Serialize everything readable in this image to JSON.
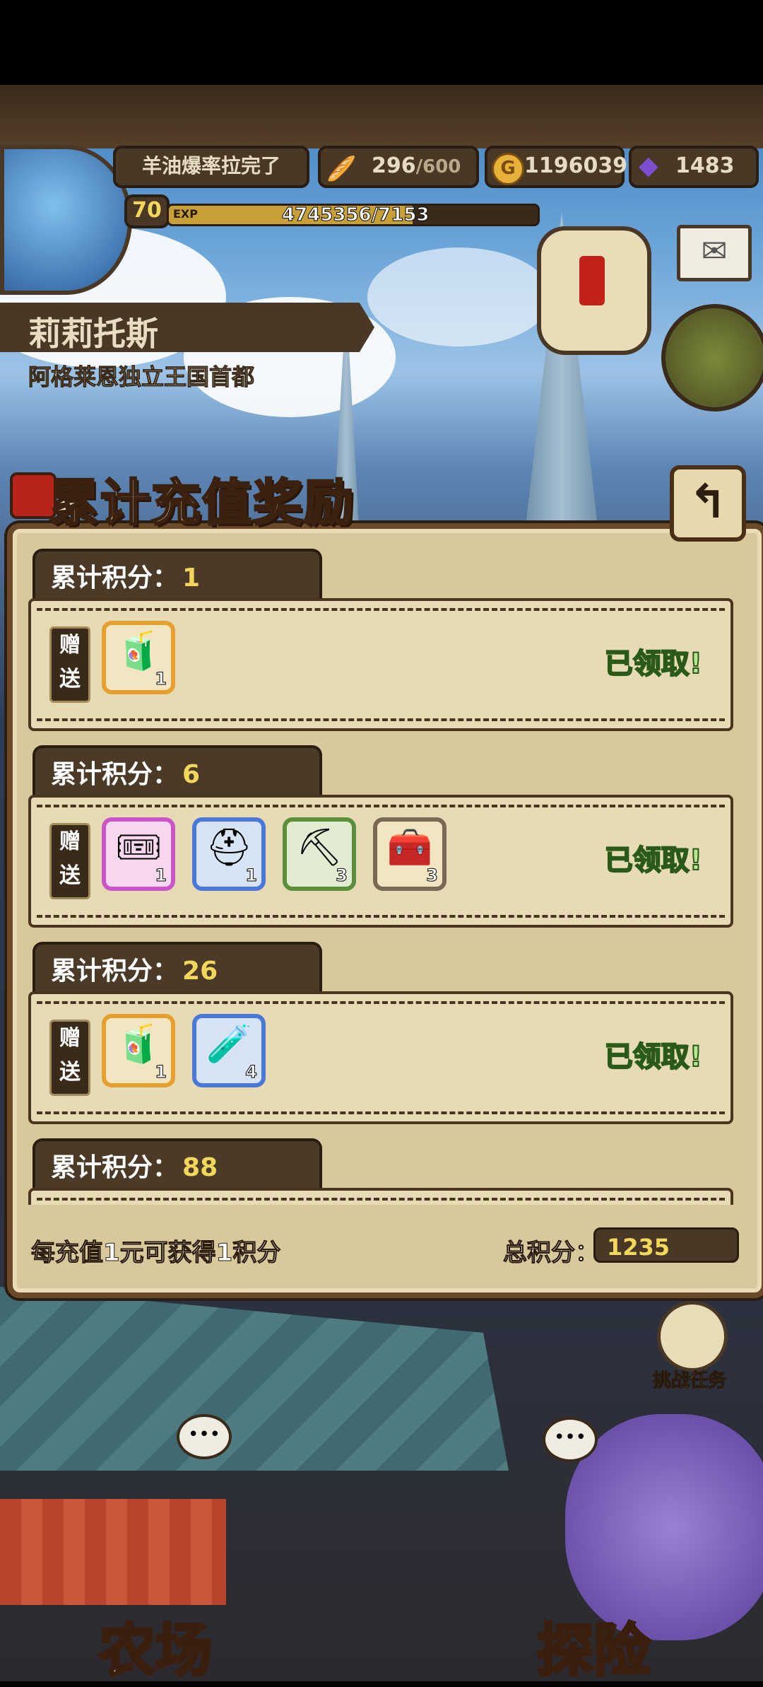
{
  "hud": {
    "player_name": "羊油爆率拉完了",
    "level": "70",
    "exp_label": "EXP",
    "exp_value": "4745356/7153",
    "stamina_current": "296",
    "stamina_max": "/600",
    "gold": "1196039",
    "gems": "1483",
    "stamina_progress": 0.49,
    "exp_progress": 0.66
  },
  "location": {
    "name": "莉莉托斯",
    "subtitle": "阿格莱恩独立王国首都"
  },
  "panel": {
    "title": "累计充值奖励",
    "tiers": [
      {
        "label": "累计积分：",
        "points": "1",
        "gift_label": "赠送",
        "status": "已领取!",
        "items": [
          {
            "icon": "potion-icon",
            "qty": "1",
            "frame": "#e6a030"
          }
        ]
      },
      {
        "label": "累计积分：",
        "points": "6",
        "gift_label": "赠送",
        "status": "已领取!",
        "items": [
          {
            "icon": "ticket-icon",
            "qty": "1",
            "frame": "#c955c9"
          },
          {
            "icon": "helmet-icon",
            "qty": "1",
            "frame": "#4a78d8"
          },
          {
            "icon": "pickaxe-icon",
            "qty": "3",
            "frame": "#5c8f3a"
          },
          {
            "icon": "chest-icon",
            "qty": "3",
            "frame": "#7a6a55"
          }
        ]
      },
      {
        "label": "累计积分：",
        "points": "26",
        "gift_label": "赠送",
        "status": "已领取!",
        "items": [
          {
            "icon": "potion-icon",
            "qty": "1",
            "frame": "#e6a030"
          },
          {
            "icon": "green-tank-icon",
            "qty": "4",
            "frame": "#4a78d8"
          }
        ]
      },
      {
        "label": "累计积分：",
        "points": "88"
      }
    ],
    "footer_note": "每充值1元可获得1积分",
    "total_label": "总积分：",
    "total_value": "1235"
  },
  "bottom": {
    "challenge_label": "挑战任务",
    "farm_label": "农场",
    "explore_label": "探险"
  }
}
